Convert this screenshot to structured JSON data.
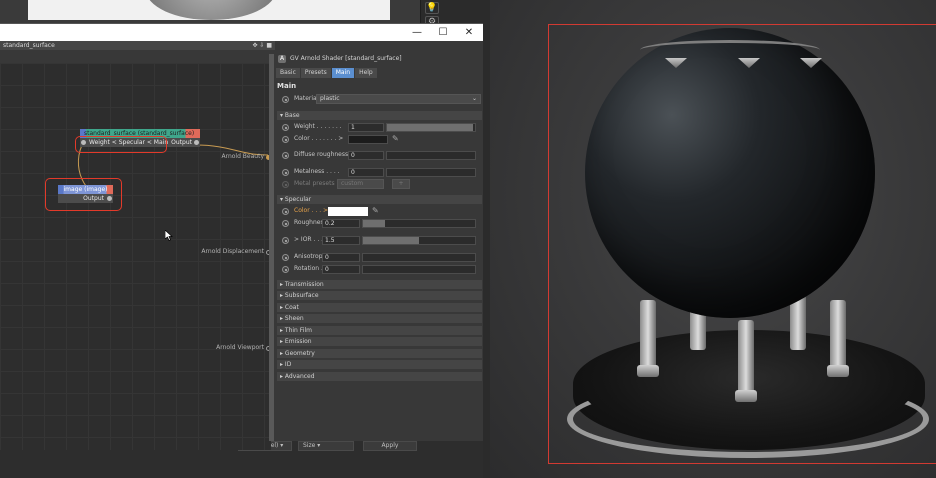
{
  "window": {
    "minimize": "—",
    "maximize": "☐",
    "close": "✕"
  },
  "node_editor": {
    "header": "standard_surface",
    "header_icons": "✥ ⇩ ■",
    "node_main_title": "standard_surface (standard_surface)",
    "node_main_row": "Weight < Specular < Main",
    "node_main_output": "Output",
    "node_image_title": "image (image)",
    "node_image_output": "Output",
    "port_beauty": "Arnold Beauty",
    "port_displacement": "Arnold Displacement",
    "port_viewport": "Arnold Viewport"
  },
  "panel": {
    "title": "GV Arnold Shader [standard_surface]",
    "tabs": [
      "Basic",
      "Presets",
      "Main",
      "Help"
    ],
    "active_tab": "Main",
    "main_label": "Main",
    "material_label": "Material",
    "material_value": "plastic",
    "base": {
      "header": "▾ Base",
      "weight_label": "Weight . . . . . . .",
      "weight_value": "1",
      "color_label": "Color . . . . . . . >",
      "diffuse_label": "Diffuse roughness",
      "diffuse_value": "0",
      "metalness_label": "Metalness . . . .",
      "metalness_value": "0",
      "metal_presets_label": "Metal presets",
      "metal_presets_value": "custom",
      "metal_presets_btn": "+"
    },
    "specular": {
      "header": "▾ Specular",
      "color_label": "Color . . . >",
      "roughness_label": "Roughness",
      "roughness_value": "0.2",
      "ior_label": "> IOR . . . . .",
      "ior_value": "1.5",
      "aniso_label": "Anisotropy",
      "aniso_value": "0",
      "rotation_label": "Rotation . .",
      "rotation_value": "0"
    },
    "sections": [
      "▸ Transmission",
      "▸ Subsurface",
      "▸ Coat",
      "▸ Sheen",
      "▸ Thin Film",
      "▸ Emission",
      "▸ Geometry",
      "▸ ID",
      "▸ Advanced"
    ]
  },
  "lower_bar": {
    "object_rel": "Object (Rel)",
    "size": "Size",
    "apply": "Apply"
  },
  "colors": {
    "accent_tab": "#5b8fd0",
    "selection": "#e33a2a",
    "node_header_green": "#3fa68b",
    "node_header_blue": "#5a78c8",
    "render_frame": "#d23a32"
  }
}
